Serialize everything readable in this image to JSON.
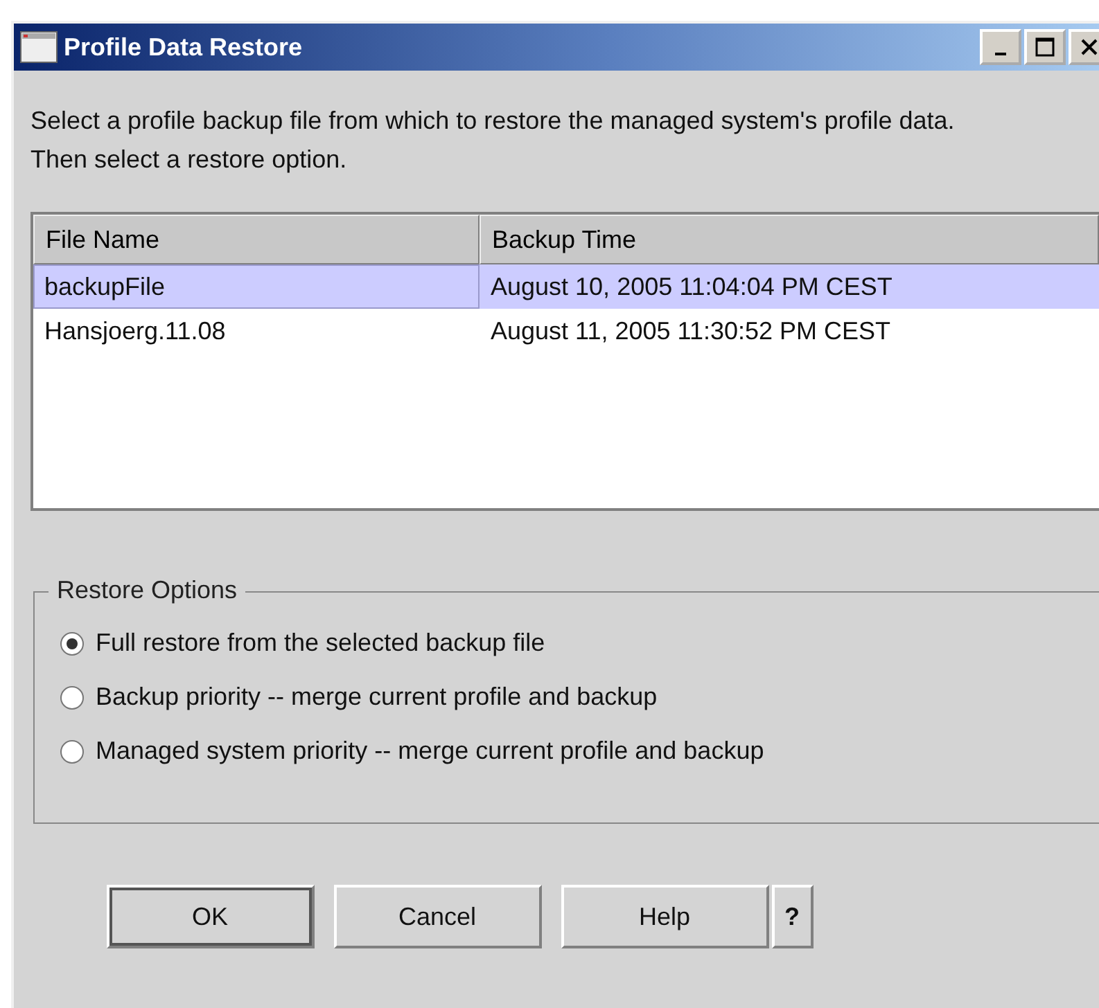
{
  "window": {
    "title": "Profile Data Restore"
  },
  "description": "Select a profile backup file from which to restore the managed system's profile data.  Then select a restore option.",
  "table": {
    "columns": [
      "File Name",
      "Backup Time"
    ],
    "rows": [
      {
        "cells": [
          "backupFile",
          "August 10, 2005 11:04:04 PM CEST"
        ],
        "selected": true
      },
      {
        "cells": [
          "Hansjoerg.11.08",
          "August 11, 2005 11:30:52 PM CEST"
        ],
        "selected": false
      }
    ]
  },
  "restore_options": {
    "title": "Restore Options",
    "options": [
      {
        "label": "Full restore from the selected backup file",
        "selected": true
      },
      {
        "label": "Backup priority -- merge current profile and backup",
        "selected": false
      },
      {
        "label": "Managed system priority -- merge current profile and backup",
        "selected": false
      }
    ]
  },
  "buttons": [
    {
      "label": "OK",
      "kind": "default"
    },
    {
      "label": "Cancel",
      "kind": "normal"
    },
    {
      "label": "Help",
      "kind": "normal"
    },
    {
      "label": "?",
      "kind": "small"
    }
  ]
}
